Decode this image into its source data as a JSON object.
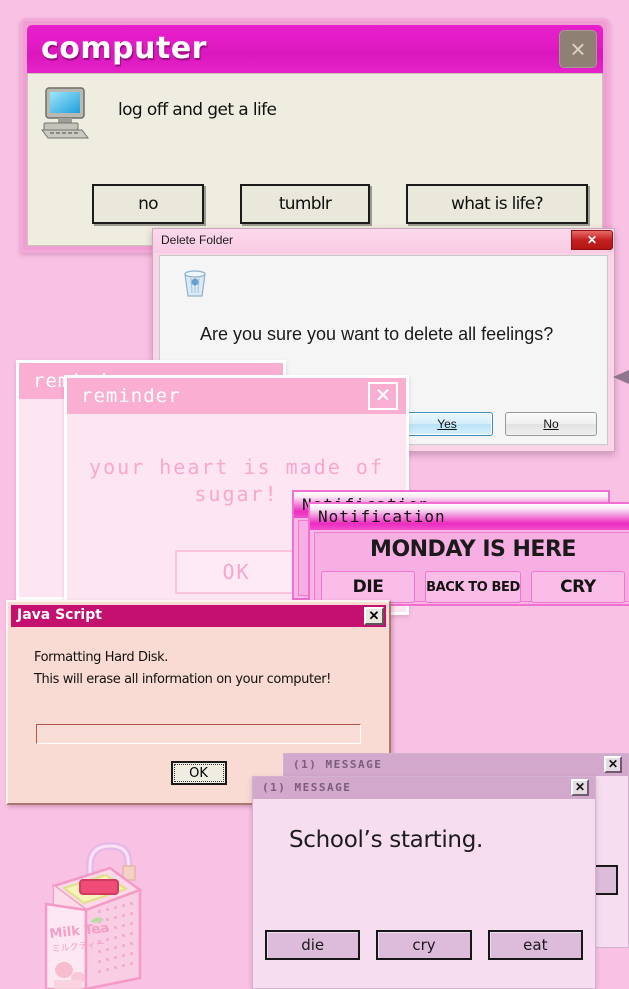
{
  "background_color": "#f9c2e4",
  "computer_window": {
    "title": "computer",
    "close_label": "×",
    "icon": "desktop-computer-icon",
    "message": "log off and get a life",
    "buttons": [
      {
        "label": "no"
      },
      {
        "label": "tumblr"
      },
      {
        "label": "what is life?"
      }
    ],
    "titlebar_color": "#e01bc4",
    "body_color": "#efeddf"
  },
  "delete_window": {
    "title": "Delete Folder",
    "close_label": "✕",
    "icon": "recycle-bin-icon",
    "message": "Are you sure you want to delete all feelings?",
    "buttons": [
      {
        "label": "Yes",
        "accel": "Y",
        "default": true
      },
      {
        "label": "No",
        "accel": "N",
        "default": false
      }
    ],
    "titlebar_color": "#f8cbe4",
    "close_color": "#c52020"
  },
  "reminder_back": {
    "title": "reminder",
    "close_label": "✕"
  },
  "reminder_front": {
    "title": "reminder",
    "close_label": "✕",
    "message": "your heart is made of sugar!",
    "ok_label": "OK",
    "titlebar_color": "#f9aed2",
    "text_color": "#f9a7cf"
  },
  "notification_back": {
    "title": "Notification"
  },
  "notification_front": {
    "title": "Notification",
    "heading": "MONDAY IS HERE",
    "buttons": [
      {
        "label": "DIE"
      },
      {
        "label": "BACK TO BED"
      },
      {
        "label": "CRY"
      }
    ],
    "titlebar_color": "#ec2bbf",
    "body_color": "#f7aee2"
  },
  "javascript_window": {
    "title": "Java Script",
    "close_label": "✕",
    "line1": "Formatting Hard Disk.",
    "line2": "This will erase all information on your computer!",
    "input_value": "",
    "input_placeholder": "",
    "ok_label": "OK",
    "titlebar_color": "#c4106f",
    "body_color": "#f9dbd3"
  },
  "message_back": {
    "title": "(1) MESSAGE",
    "close_label": "✕"
  },
  "message_front": {
    "title": "(1) MESSAGE",
    "close_label": "✕",
    "message": "School’s starting.",
    "buttons": [
      {
        "label": "die"
      },
      {
        "label": "cry"
      },
      {
        "label": "eat"
      }
    ],
    "titlebar_color": "#d3a8cd",
    "body_color": "#f7ddf0"
  },
  "decoration": {
    "milk_tea_label": "Milk Tea",
    "milk_tea_label_jp": "ミルクティー"
  }
}
